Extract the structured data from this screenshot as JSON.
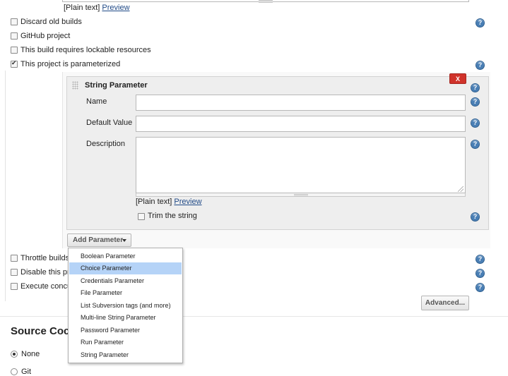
{
  "top_editor": {
    "plain_text": "[Plain text]",
    "preview": "Preview"
  },
  "options": [
    {
      "label": "Discard old builds",
      "checked": false
    },
    {
      "label": "GitHub project",
      "checked": false
    },
    {
      "label": "This build requires lockable resources",
      "checked": false
    },
    {
      "label": "This project is parameterized",
      "checked": true
    }
  ],
  "param_block": {
    "title": "String Parameter",
    "delete_label": "X",
    "fields": {
      "name_label": "Name",
      "default_label": "Default Value",
      "description_label": "Description"
    },
    "plain_text": "[Plain text]",
    "preview": "Preview",
    "trim_label": "Trim the string"
  },
  "add_parameter": {
    "label": "Add Parameter",
    "menu": [
      "Boolean Parameter",
      "Choice Parameter",
      "Credentials Parameter",
      "File Parameter",
      "List Subversion tags (and more)",
      "Multi-line String Parameter",
      "Password Parameter",
      "Run Parameter",
      "String Parameter"
    ],
    "highlighted_index": 1
  },
  "more_options": [
    {
      "label": "Throttle builds",
      "checked": false
    },
    {
      "label": "Disable this pro",
      "checked": false
    },
    {
      "label": "Execute concu",
      "checked": false
    }
  ],
  "advanced_button": "Advanced...",
  "scm": {
    "heading": "Source Coc",
    "none_label": "None",
    "git_label": "Git"
  },
  "icons": {
    "help": "?"
  }
}
